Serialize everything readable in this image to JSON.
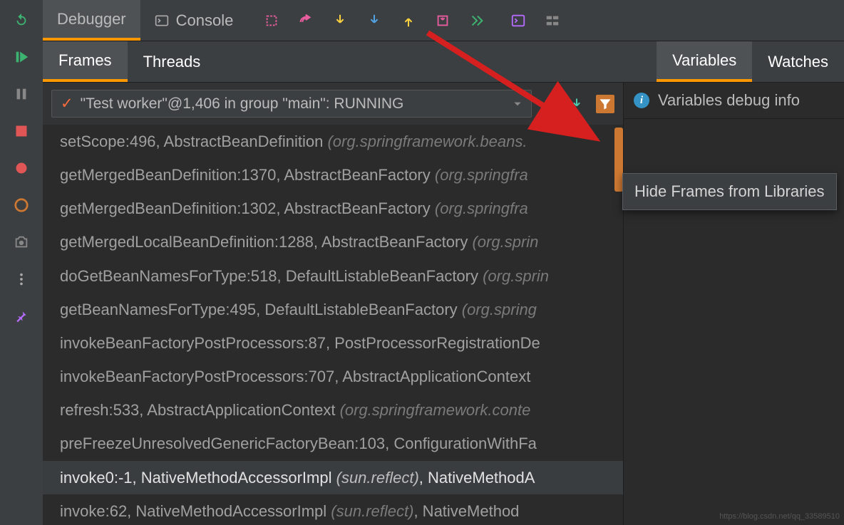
{
  "topTabs": {
    "debugger": "Debugger",
    "console": "Console"
  },
  "secondTabs": {
    "frames": "Frames",
    "threads": "Threads",
    "variables": "Variables",
    "watches": "Watches"
  },
  "threadSelect": "\"Test worker\"@1,406 in group \"main\": RUNNING",
  "varsInfo": "Variables debug info",
  "tooltip": "Hide Frames from Libraries",
  "frames": [
    {
      "method": "setScope:496, AbstractBeanDefinition ",
      "pkg": "(org.springframework.beans.",
      "highlight": false
    },
    {
      "method": "getMergedBeanDefinition:1370, AbstractBeanFactory ",
      "pkg": "(org.springfra",
      "highlight": false
    },
    {
      "method": "getMergedBeanDefinition:1302, AbstractBeanFactory ",
      "pkg": "(org.springfra",
      "highlight": false
    },
    {
      "method": "getMergedLocalBeanDefinition:1288, AbstractBeanFactory ",
      "pkg": "(org.sprin",
      "highlight": false
    },
    {
      "method": "doGetBeanNamesForType:518, DefaultListableBeanFactory ",
      "pkg": "(org.sprin",
      "highlight": false
    },
    {
      "method": "getBeanNamesForType:495, DefaultListableBeanFactory ",
      "pkg": "(org.spring",
      "highlight": false
    },
    {
      "method": "invokeBeanFactoryPostProcessors:87, PostProcessorRegistrationDe",
      "pkg": "",
      "highlight": false
    },
    {
      "method": "invokeBeanFactoryPostProcessors:707, AbstractApplicationContext",
      "pkg": "",
      "highlight": false
    },
    {
      "method": "refresh:533, AbstractApplicationContext ",
      "pkg": "(org.springframework.conte",
      "highlight": false
    },
    {
      "method": "preFreezeUnresolvedGenericFactoryBean:103, ConfigurationWithFa",
      "pkg": "",
      "highlight": false
    },
    {
      "method": "invoke0:-1, NativeMethodAccessorImpl ",
      "pkg": "(sun.reflect)",
      "tail": ", NativeMethodA",
      "highlight": true
    },
    {
      "method": "invoke:62, NativeMethodAccessorImpl ",
      "pkg": "(sun.reflect)",
      "tail": ", NativeMethod",
      "highlight": false
    }
  ],
  "watermark": "https://blog.csdn.net/qq_33589510"
}
